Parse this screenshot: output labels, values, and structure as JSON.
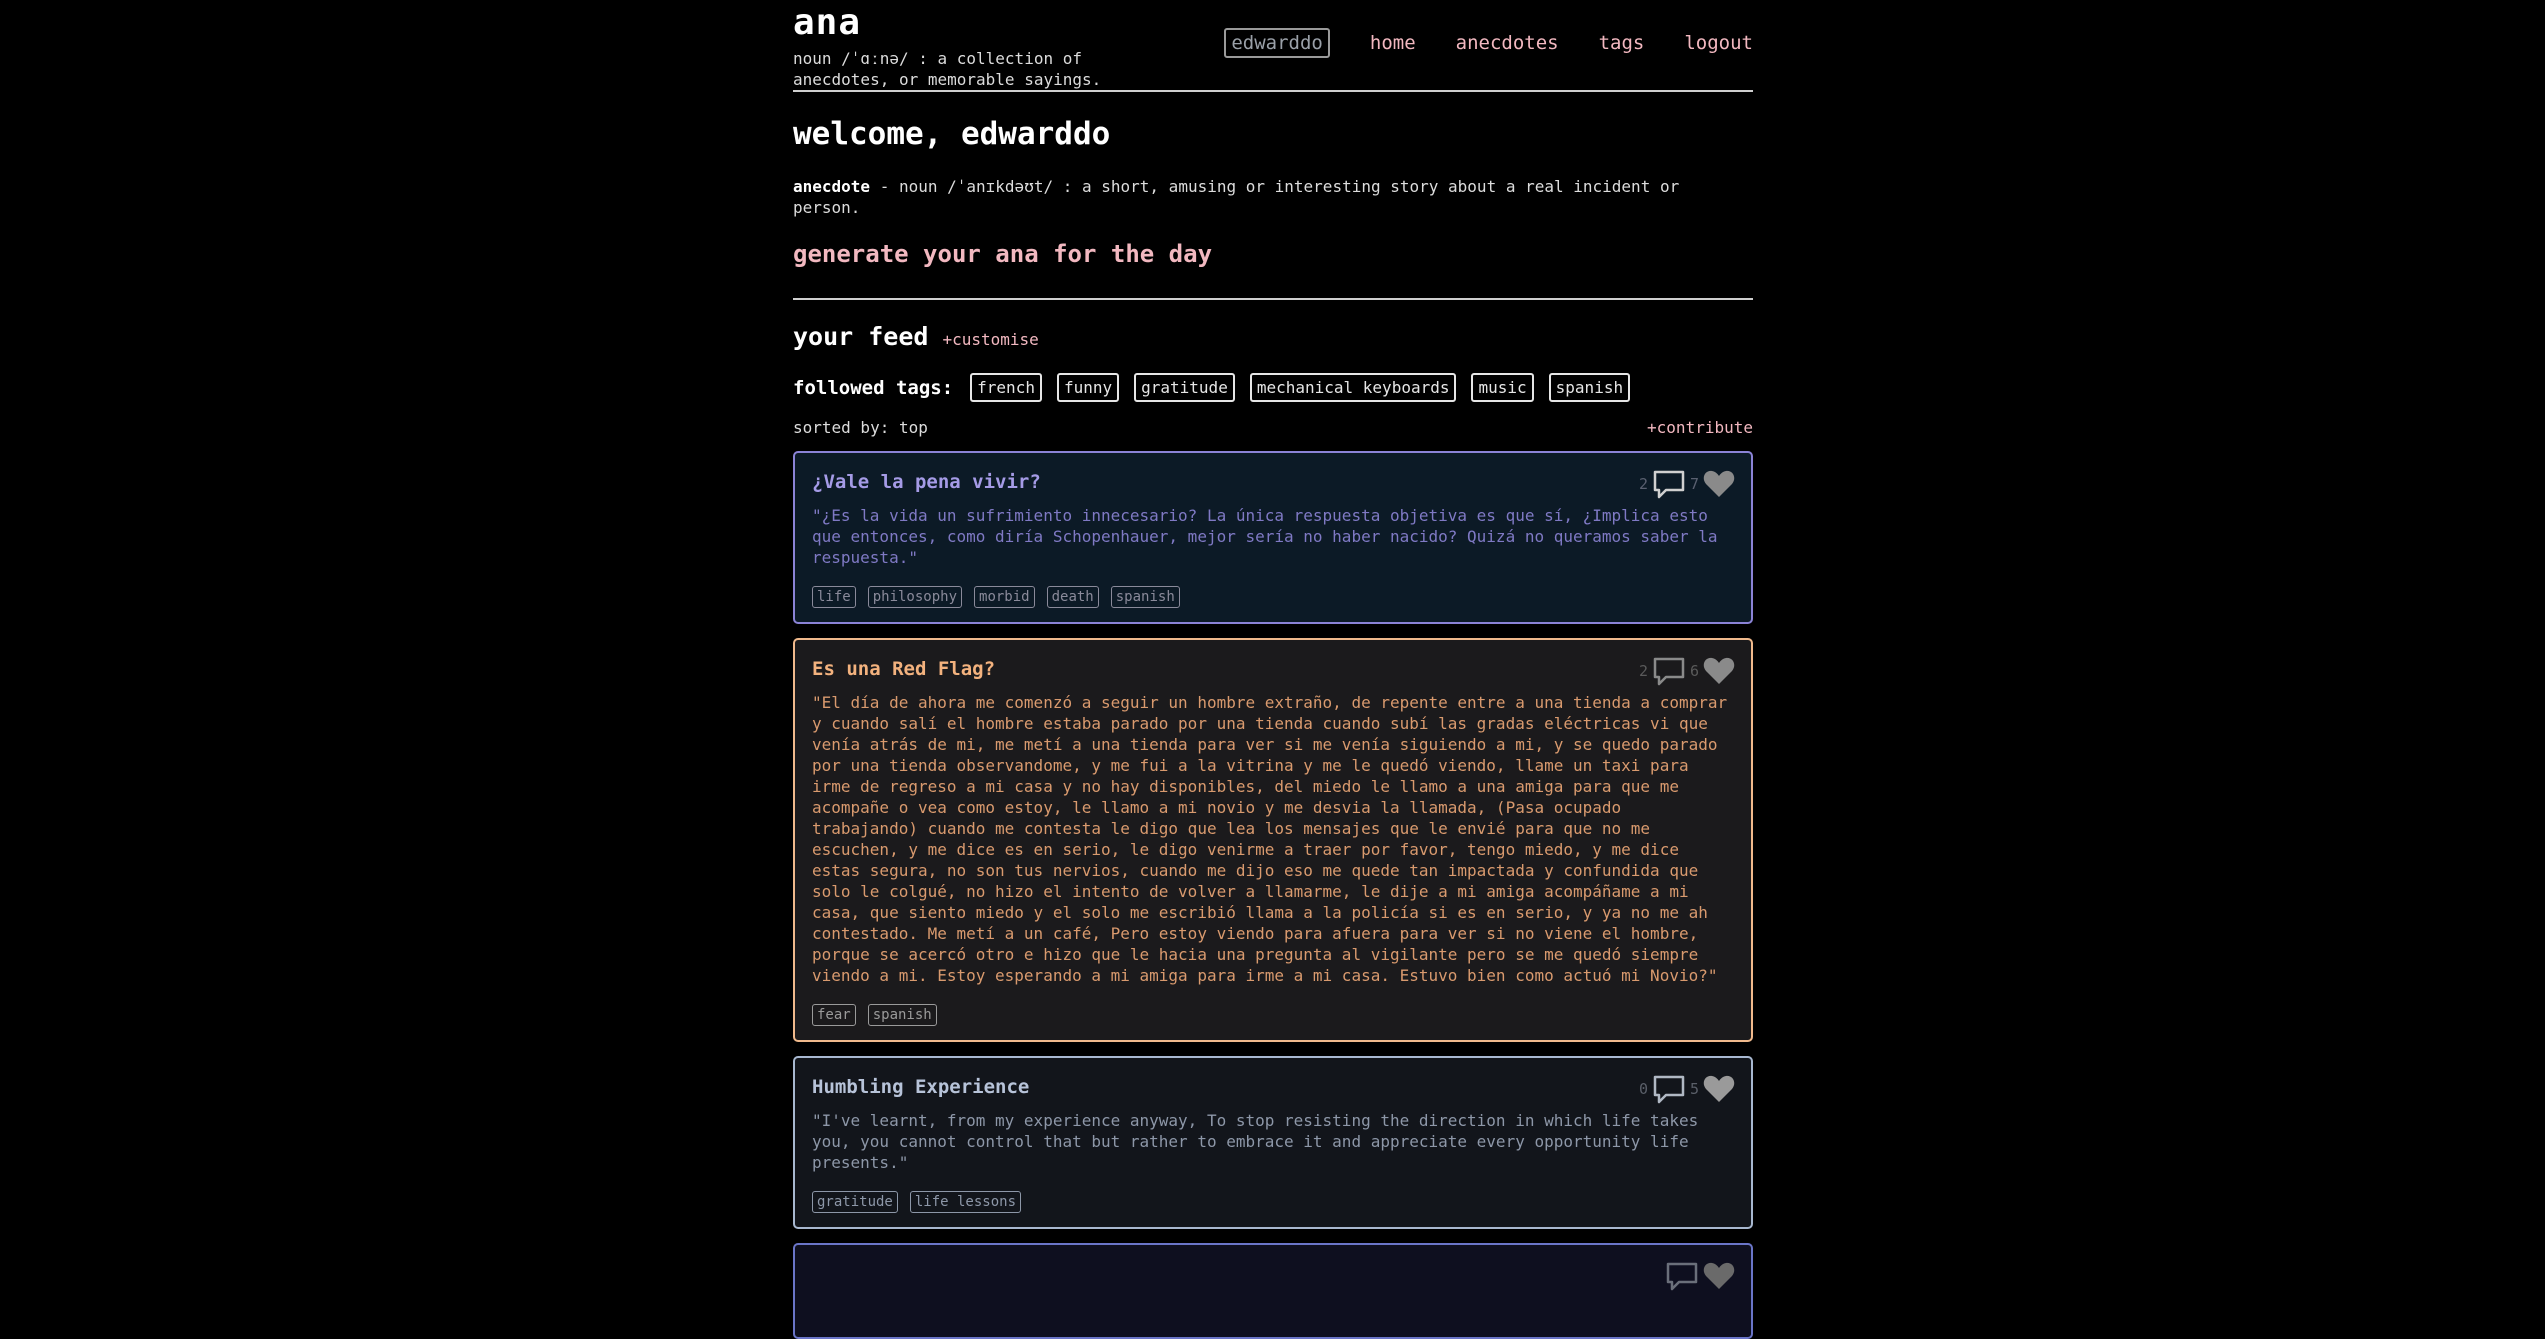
{
  "header": {
    "brand": "ana",
    "brand_definition": "noun /ˈɑːnə/ : a collection of anecdotes, or memorable sayings.",
    "nav": {
      "user": "edwarddo",
      "home": "home",
      "anecdotes": "anecdotes",
      "tags": "tags",
      "logout": "logout"
    }
  },
  "intro": {
    "welcome": "welcome, edwarddo",
    "definition_term": "anecdote",
    "definition_text": " - noun /ˈanɪkdəʊt/ : a short, amusing or interesting story about a real incident or person.",
    "generate_link": "generate your ana for the day"
  },
  "feed": {
    "title": "your feed",
    "customise": "+customise",
    "followed_label": "followed tags:",
    "followed_tags": [
      "french",
      "funny",
      "gratitude",
      "mechanical keyboards",
      "music",
      "spanish"
    ],
    "sorted_by": "sorted by: top",
    "contribute": "+contribute",
    "colors": {
      "accent_pink": "#f2b8c0",
      "card1_border": "#8b83d6",
      "card2_border": "#f0b98c",
      "card3_border": "#a8b8d0"
    },
    "icons": [
      "comment-icon",
      "heart-icon"
    ],
    "anecdotes": [
      {
        "title": "¿Vale la pena vivir?",
        "text": "\"¿Es la vida un sufrimiento innecesario? La única respuesta objetiva es que sí, ¿Implica esto que entonces, como diría Schopenhauer, mejor sería no haber nacido? Quizá no queramos saber la respuesta.\"",
        "comments": "2",
        "likes": "7",
        "tags": [
          "life",
          "philosophy",
          "morbid",
          "death",
          "spanish"
        ]
      },
      {
        "title": "Es una Red Flag?",
        "text": "\"El día de ahora me comenzó a seguir un hombre extraño, de repente entre a una tienda a comprar y cuando salí el hombre estaba parado por una tienda cuando subí las gradas eléctricas vi que venía atrás de mi, me metí a una tienda para ver si me venía siguiendo a mi, y se quedo parado por una tienda observandome, y me fui a la vitrina y me le quedó viendo, llame un taxi para irme de regreso a mi casa y no hay disponibles, del miedo le llamo a una amiga para que me acompañe o vea como estoy, le llamo a mi novio y me desvia la llamada, (Pasa ocupado trabajando) cuando me contesta le digo que lea los mensajes que le envié para que no me escuchen, y me dice es en serio, le digo venirme a traer por favor, tengo miedo, y me dice estas segura, no son tus nervios, cuando me dijo eso me quede tan impactada y confundida que solo le colgué, no hizo el intento de volver a llamarme, le dije a mi amiga acompáñame a mi casa, que siento miedo y el solo me escribió llama a la policía si es en serio, y ya no me ah contestado. Me metí a un café, Pero estoy viendo para afuera para ver si no viene el hombre, porque se acercó otro e hizo que le hacia una pregunta al vigilante pero se me quedó siempre viendo a mi. Estoy esperando a mi amiga para irme a mi casa. Estuvo bien como actuó mi Novio?\"",
        "comments": "2",
        "likes": "6",
        "tags": [
          "fear",
          "spanish"
        ]
      },
      {
        "title": "Humbling Experience",
        "text": "\"I've learnt, from my experience anyway, To stop resisting the direction in which life takes you, you cannot control that but rather to embrace it and appreciate every opportunity life presents.\"",
        "comments": "0",
        "likes": "5",
        "tags": [
          "gratitude",
          "life lessons"
        ]
      }
    ]
  }
}
